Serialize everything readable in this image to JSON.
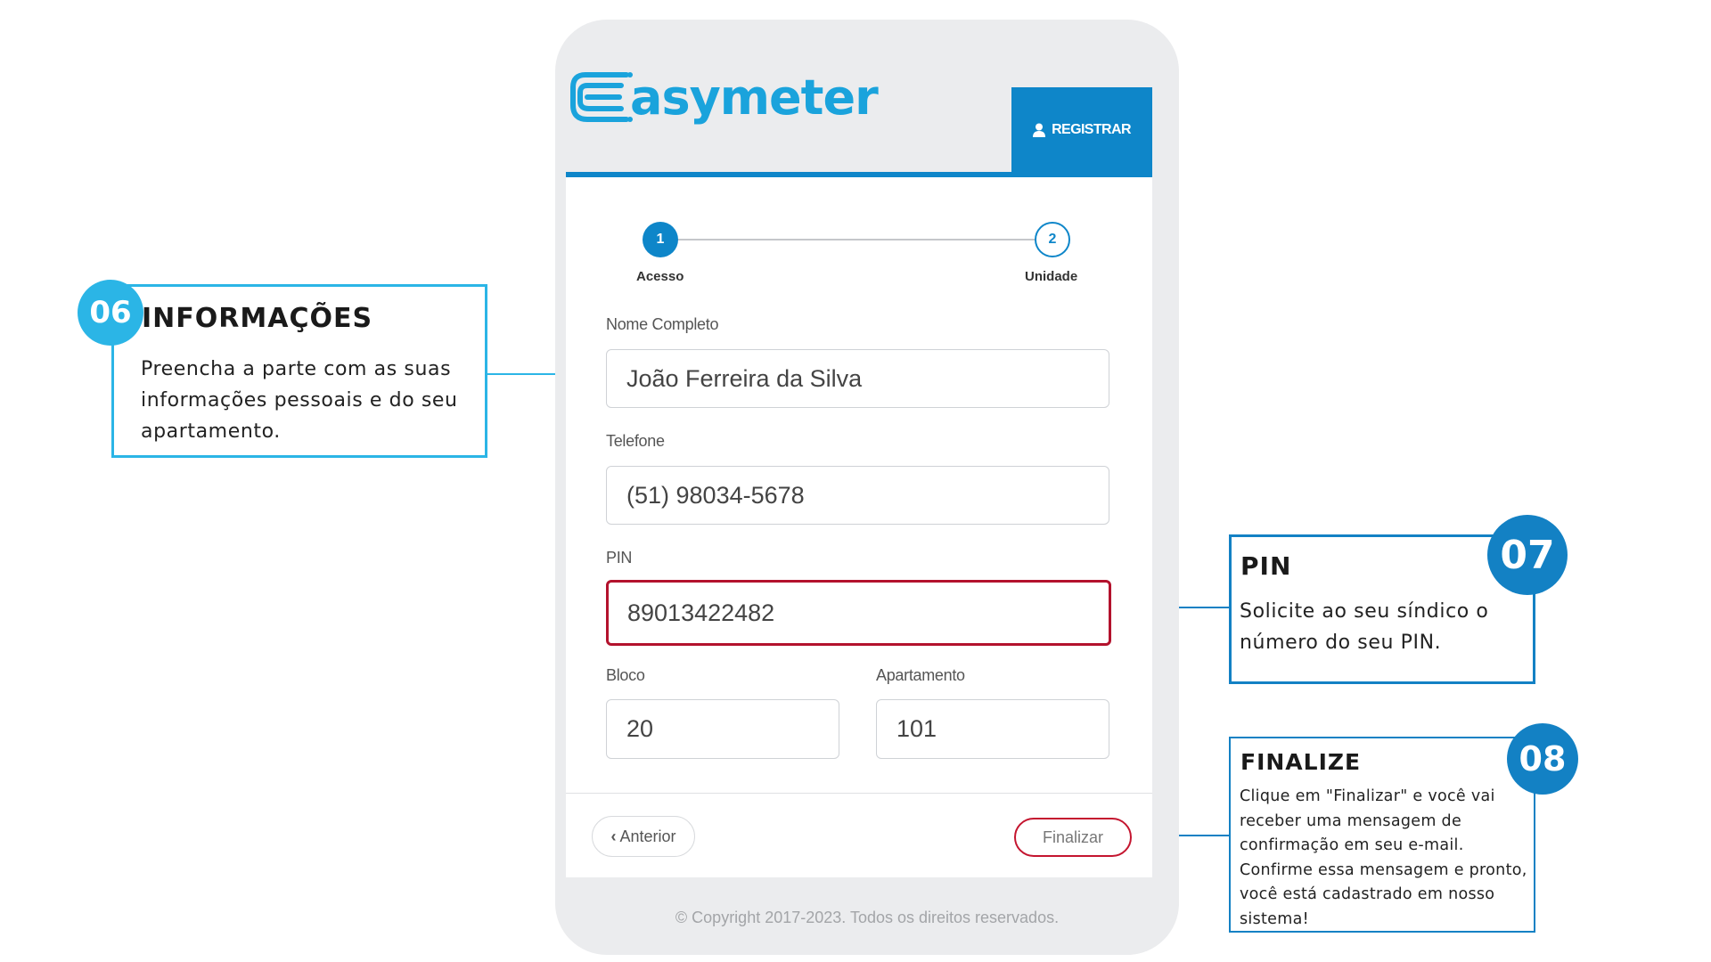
{
  "brand": {
    "logo_text": "asymeter",
    "logo_color": "#1aa3dc",
    "accent": "#0e86c9",
    "error": "#b3122d"
  },
  "header": {
    "register_label": "REGISTRAR",
    "register_icon": "user-icon"
  },
  "stepper": {
    "steps": [
      {
        "number": "1",
        "label": "Acesso",
        "active": true
      },
      {
        "number": "2",
        "label": "Unidade",
        "active": false
      }
    ]
  },
  "form": {
    "name": {
      "label": "Nome Completo",
      "value": "João Ferreira da Silva"
    },
    "phone": {
      "label": "Telefone",
      "value": "(51) 98034-5678"
    },
    "pin": {
      "label": "PIN",
      "value": "89013422482"
    },
    "block": {
      "label": "Bloco",
      "value": "20"
    },
    "apartment": {
      "label": "Apartamento",
      "value": "101"
    }
  },
  "footer": {
    "prev_label": "Anterior",
    "prev_icon": "chevron-left-icon",
    "finish_label": "Finalizar",
    "copyright": "© Copyright 2017-2023. Todos os direitos reservados."
  },
  "annotations": {
    "info": {
      "number": "06",
      "title": "INFORMAÇÕES",
      "lines": [
        "Preencha a parte com as suas",
        "informações pessoais e do seu",
        "apartamento."
      ]
    },
    "pin": {
      "number": "07",
      "title": "PIN",
      "lines": [
        "Solicite ao seu síndico o",
        "número do seu PIN."
      ]
    },
    "finalize": {
      "number": "08",
      "title": "FINALIZE",
      "lines": [
        "Clique em \"Finalizar\" e você vai",
        "receber uma mensagem de",
        "confirmação em seu e-mail.",
        "Confirme essa mensagem e pronto,",
        "você está cadastrado em nosso",
        "sistema!"
      ]
    },
    "colors": {
      "cyan": "#2bb5e6",
      "blue": "#1381c4"
    }
  }
}
